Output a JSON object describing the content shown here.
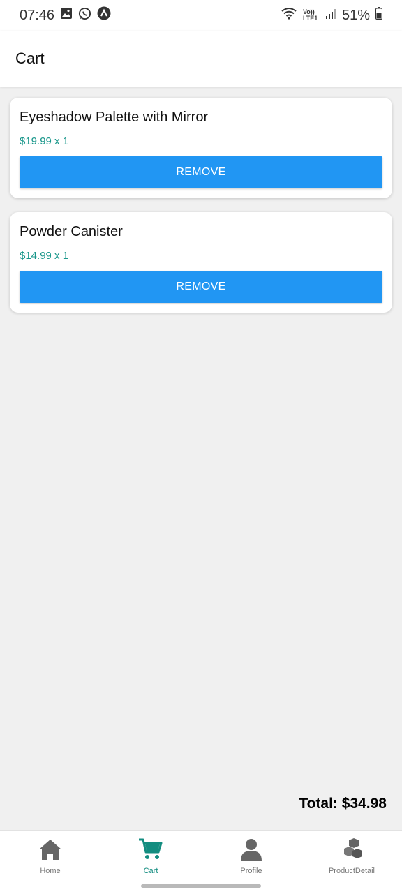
{
  "status_bar": {
    "time": "07:46",
    "battery": "51%",
    "network_label": "Vo)) LTE1",
    "icons": [
      "gallery-icon",
      "whatsapp-icon",
      "app-a-icon",
      "wifi-icon",
      "signal-icon",
      "battery-icon"
    ]
  },
  "header": {
    "title": "Cart"
  },
  "cart": {
    "items": [
      {
        "name": "Eyeshadow Palette with Mirror",
        "price_qty": "$19.99 x 1",
        "remove_label": "REMOVE"
      },
      {
        "name": "Powder Canister",
        "price_qty": "$14.99 x 1",
        "remove_label": "REMOVE"
      }
    ],
    "total": "Total: $34.98"
  },
  "nav": {
    "items": [
      {
        "label": "Home",
        "icon": "home-icon",
        "active": false
      },
      {
        "label": "Cart",
        "icon": "cart-icon",
        "active": true
      },
      {
        "label": "Profile",
        "icon": "person-icon",
        "active": false
      },
      {
        "label": "ProductDetail",
        "icon": "cubes-icon",
        "active": false
      }
    ]
  },
  "colors": {
    "primary_button": "#2196f3",
    "price_text": "#18968a",
    "nav_active": "#138d80",
    "nav_inactive": "#777777",
    "background": "#f0f0f0"
  }
}
